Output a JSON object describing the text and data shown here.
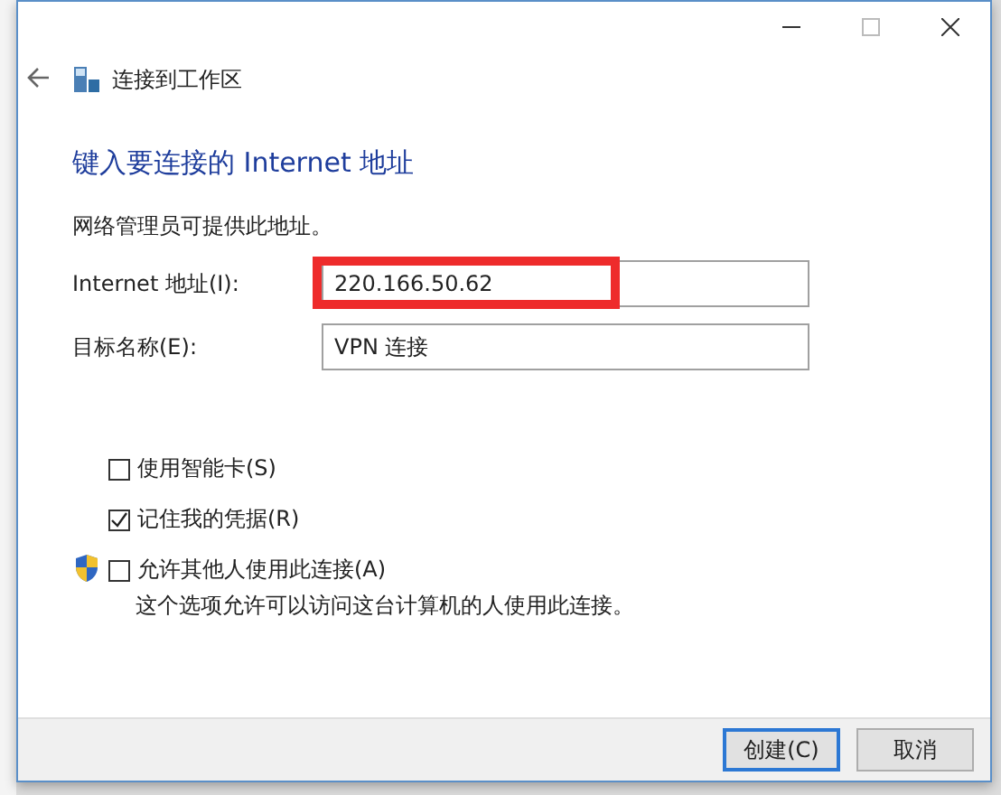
{
  "window": {
    "title": "连接到工作区"
  },
  "heading": "键入要连接的 Internet 地址",
  "description": "网络管理员可提供此地址。",
  "fields": [
    {
      "label": "Internet 地址(I):",
      "value": "220.166.50.62",
      "highlighted": true
    },
    {
      "label": "目标名称(E):",
      "value": "VPN 连接",
      "highlighted": false
    }
  ],
  "options": [
    {
      "label": "使用智能卡(S)",
      "checked": false,
      "shield": false
    },
    {
      "label": "记住我的凭据(R)",
      "checked": true,
      "shield": false
    },
    {
      "label": "允许其他人使用此连接(A)",
      "checked": false,
      "shield": true,
      "note": "这个选项允许可以访问这台计算机的人使用此连接。"
    }
  ],
  "buttons": [
    {
      "label": "创建(C)",
      "default": true
    },
    {
      "label": "取消",
      "default": false
    }
  ]
}
